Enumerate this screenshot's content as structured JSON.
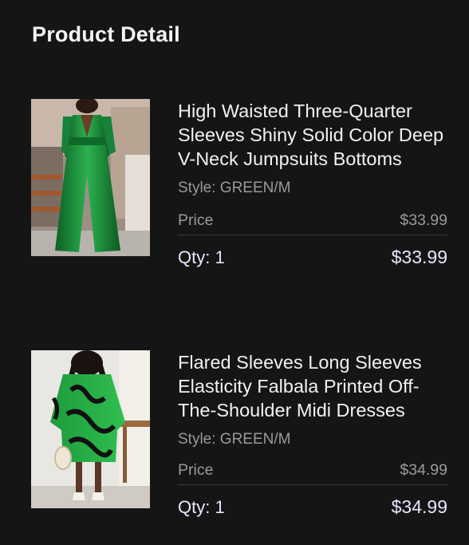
{
  "header": {
    "title": "Product Detail"
  },
  "products": [
    {
      "name": "High Waisted Three-Quarter Sleeves Shiny Solid Color Deep V-Neck Jumpsuits Bottoms",
      "style": "Style: GREEN/M",
      "price_label": "Price",
      "price": "$33.99",
      "qty": "Qty: 1",
      "total": "$33.99"
    },
    {
      "name": "Flared Sleeves Long Sleeves Elasticity Falbala Printed Off-The-Shoulder Midi Dresses",
      "style": "Style: GREEN/M",
      "price_label": "Price",
      "price": "$34.99",
      "qty": "Qty: 1",
      "total": "$34.99"
    }
  ],
  "colors": {
    "background": "#151515",
    "text_primary": "#f2f2f2",
    "text_secondary": "#9a9a9a",
    "total_text": "#e7e8ff",
    "product_green": "#1f8f3a"
  }
}
